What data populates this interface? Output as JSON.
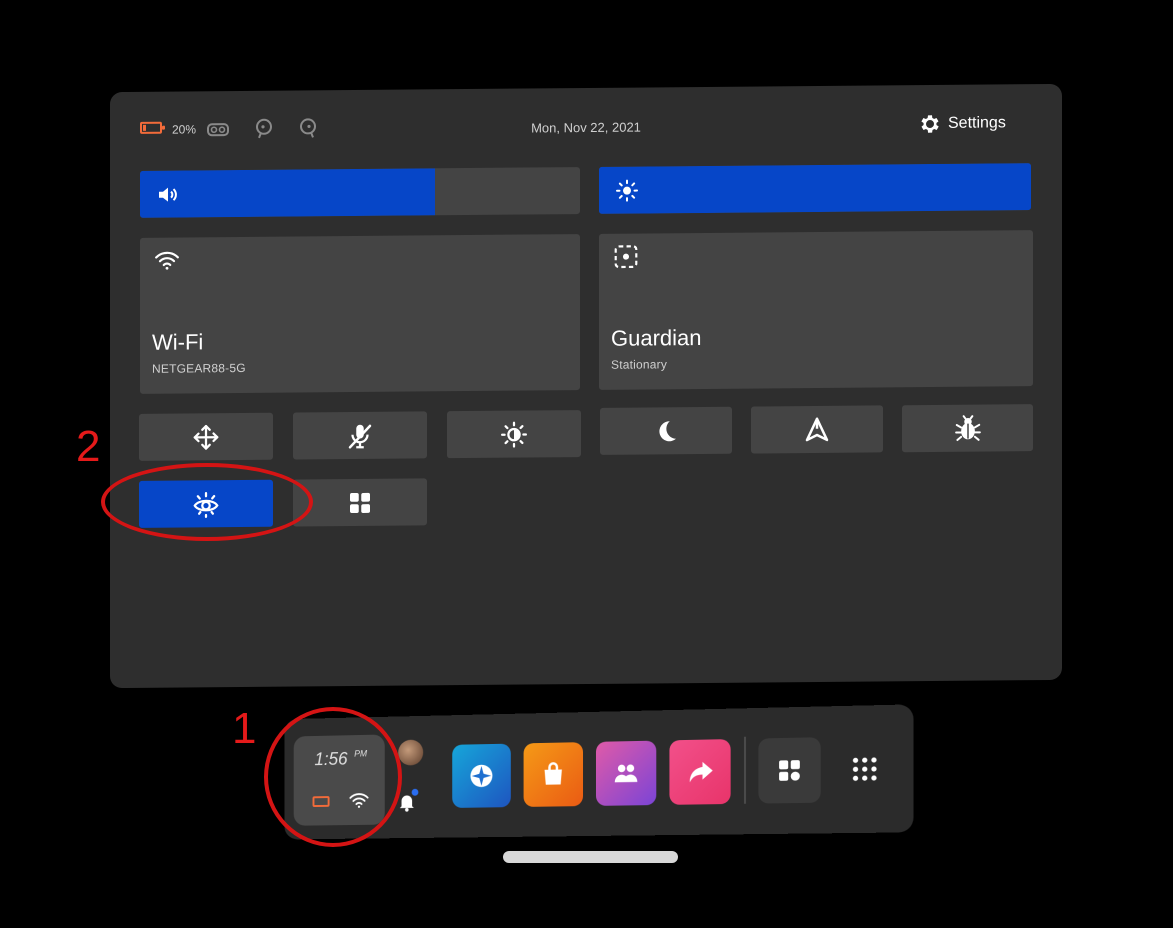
{
  "status_bar": {
    "battery_percent": "20%",
    "battery_level": 0.2,
    "battery_color": "#f26b3a",
    "icons": [
      "battery-icon",
      "headset-icon",
      "left-controller-icon",
      "right-controller-icon"
    ],
    "date": "Mon, Nov 22, 2021",
    "settings_label": "Settings"
  },
  "sliders": {
    "volume": {
      "icon": "speaker-icon",
      "level": 0.67
    },
    "brightness": {
      "icon": "sun-icon",
      "level": 1.0
    }
  },
  "tiles": {
    "wifi": {
      "icon": "wifi-icon",
      "title": "Wi-Fi",
      "subtitle": "NETGEAR88-5G"
    },
    "guardian": {
      "icon": "guardian-icon",
      "title": "Guardian",
      "subtitle": "Stationary"
    }
  },
  "quick_actions": [
    {
      "icon": "move-icon",
      "active": false
    },
    {
      "icon": "mic-off-icon",
      "active": false
    },
    {
      "icon": "brightness-icon",
      "active": false
    },
    {
      "icon": "moon-icon",
      "active": false
    },
    {
      "icon": "casting-icon",
      "active": false
    },
    {
      "icon": "bug-icon",
      "active": false
    },
    {
      "icon": "eye-comfort-icon",
      "active": true
    },
    {
      "icon": "widgets-icon",
      "active": false
    }
  ],
  "annotations": {
    "label_1": "1",
    "label_2": "2",
    "color": "#d41414"
  },
  "dock": {
    "time": "1:56",
    "ampm": "PM",
    "apps": [
      {
        "icon": "explore-icon",
        "color": "#1f7fd0"
      },
      {
        "icon": "store-icon",
        "color": "#f07a14"
      },
      {
        "icon": "people-icon",
        "color": "#b04fc9"
      },
      {
        "icon": "share-icon",
        "color": "#e8407a"
      }
    ],
    "right_icons": [
      "widgets-icon",
      "apps-grid-icon"
    ]
  },
  "colors": {
    "accent": "#0646c8",
    "panel": "#2e2e2e",
    "tile": "#444444"
  }
}
